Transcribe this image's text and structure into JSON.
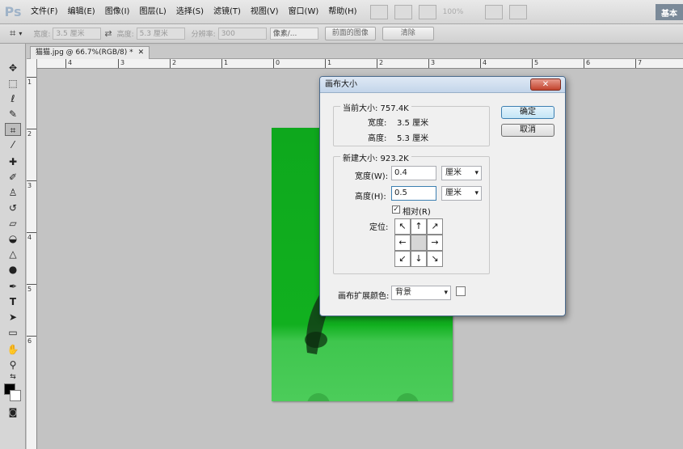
{
  "app": {
    "logo": "Ps",
    "workspace": "基本"
  },
  "menubar": {
    "items": [
      "文件(F)",
      "编辑(E)",
      "图像(I)",
      "图层(L)",
      "选择(S)",
      "滤镜(T)",
      "视图(V)",
      "窗口(W)",
      "帮助(H)"
    ],
    "zoom": "100%"
  },
  "options": {
    "width_label": "宽度:",
    "width_value": "3.5 厘米",
    "height_label": "高度:",
    "height_value": "5.3 厘米",
    "resolution_label": "分辨率:",
    "resolution_value": "300",
    "unit_value": "像素/...",
    "front_image_btn": "前面的图像",
    "clear_btn": "清除"
  },
  "document": {
    "tab_title": "猫猫.jpg @ 66.7%(RGB/8) *",
    "close": "✕"
  },
  "rulers": {
    "h_ticks": [
      "4",
      "3",
      "2",
      "1",
      "0",
      "1",
      "2",
      "3",
      "4",
      "5",
      "6",
      "7"
    ],
    "v_ticks": [
      "1",
      "2",
      "3",
      "4",
      "5",
      "6"
    ]
  },
  "dialog": {
    "title": "画布大小",
    "close": "✕",
    "current": {
      "legend": "当前大小: 757.4K",
      "width_label": "宽度:",
      "width_value": "3.5 厘米",
      "height_label": "高度:",
      "height_value": "5.3 厘米"
    },
    "new": {
      "legend": "新建大小: 923.2K",
      "width_label": "宽度(W):",
      "width_value": "0.4",
      "width_unit": "厘米",
      "height_label": "高度(H):",
      "height_value": "0.5",
      "height_unit": "厘米",
      "relative_label": "相对(R)",
      "relative_checked": "✓",
      "anchor_label": "定位:",
      "anchor_arrows": [
        "↖",
        "↑",
        "↗",
        "←",
        "",
        "→",
        "↙",
        "↓",
        "↘"
      ]
    },
    "extension_color_label": "画布扩展颜色:",
    "extension_color_value": "背景",
    "ok_btn": "确定",
    "cancel_btn": "取消"
  }
}
